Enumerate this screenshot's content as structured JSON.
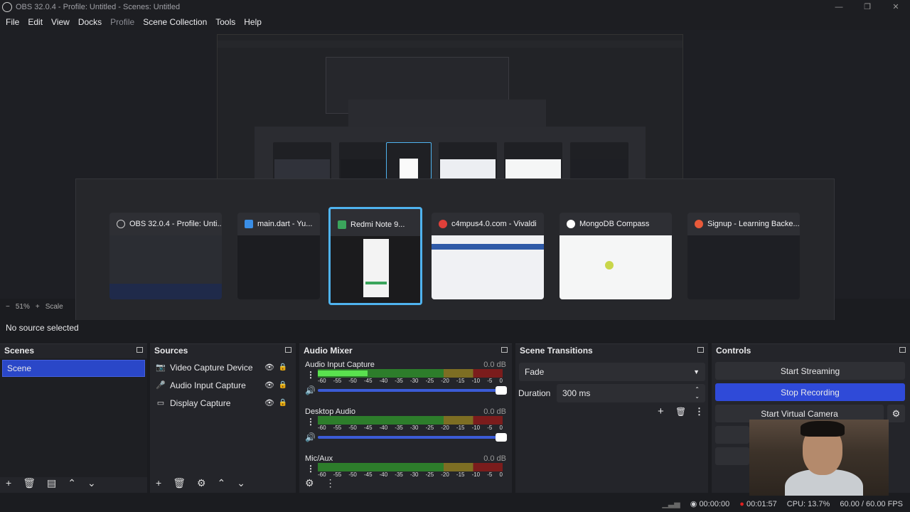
{
  "window": {
    "title": "OBS 32.0.4 - Profile: Untitled - Scenes: Untitled",
    "controls": [
      "—",
      "❐",
      "✕"
    ]
  },
  "menu": [
    "File",
    "Edit",
    "View",
    "Docks",
    "Profile",
    "Scene Collection",
    "Tools",
    "Help"
  ],
  "switcher": {
    "cards": [
      {
        "title": "OBS 32.0.4 - Profile: Unti...",
        "icon_color": "#9aa0a6",
        "thumb": "#2b2d33"
      },
      {
        "title": "main.dart - Yu...",
        "icon_color": "#3a8ee6",
        "thumb": "#1c1d21"
      },
      {
        "title": "Redmi Note 9...",
        "icon_color": "#3ba55c",
        "thumb": "#1b1b1d"
      },
      {
        "title": "c4mpus4.0.com - Vivaldi",
        "icon_color": "#e0403a",
        "thumb": "#f0f1f4"
      },
      {
        "title": "MongoDB Compass",
        "icon_color": "#ffffff",
        "thumb": "#f5f6f6"
      },
      {
        "title": "Signup - Learning Backe...",
        "icon_color": "#e85a3a",
        "thumb": "#1e1f24"
      }
    ]
  },
  "preview": {
    "zoom": "51%",
    "scale_label": "Scale",
    "no_source": "No source selected"
  },
  "scenes": {
    "title": "Scenes",
    "items": [
      "Scene"
    ]
  },
  "sources": {
    "title": "Sources",
    "items": [
      {
        "label": "Video Capture Device",
        "icon": "camera-icon"
      },
      {
        "label": "Audio Input Capture",
        "icon": "mic-icon"
      },
      {
        "label": "Display Capture",
        "icon": "monitor-icon"
      }
    ]
  },
  "mixer": {
    "title": "Audio Mixer",
    "ticks": [
      "-60",
      "-55",
      "-50",
      "-45",
      "-40",
      "-35",
      "-30",
      "-25",
      "-20",
      "-15",
      "-10",
      "-5",
      "0"
    ],
    "channels": [
      {
        "name": "Audio Input Capture",
        "db": "0.0 dB",
        "level": 0.27
      },
      {
        "name": "Desktop Audio",
        "db": "0.0 dB",
        "level": 0
      },
      {
        "name": "Mic/Aux",
        "db": "0.0 dB",
        "level": 0
      }
    ]
  },
  "transitions": {
    "title": "Scene Transitions",
    "selected": "Fade",
    "duration_label": "Duration",
    "duration_value": "300 ms"
  },
  "controls": {
    "title": "Controls",
    "buttons": [
      "Start Streaming",
      "Stop Recording",
      "Start Virtual Camera"
    ]
  },
  "status": {
    "stream_time": "00:00:00",
    "rec_time": "00:01:57",
    "cpu": "CPU: 13.7%",
    "fps": "60.00 / 60.00 FPS"
  }
}
